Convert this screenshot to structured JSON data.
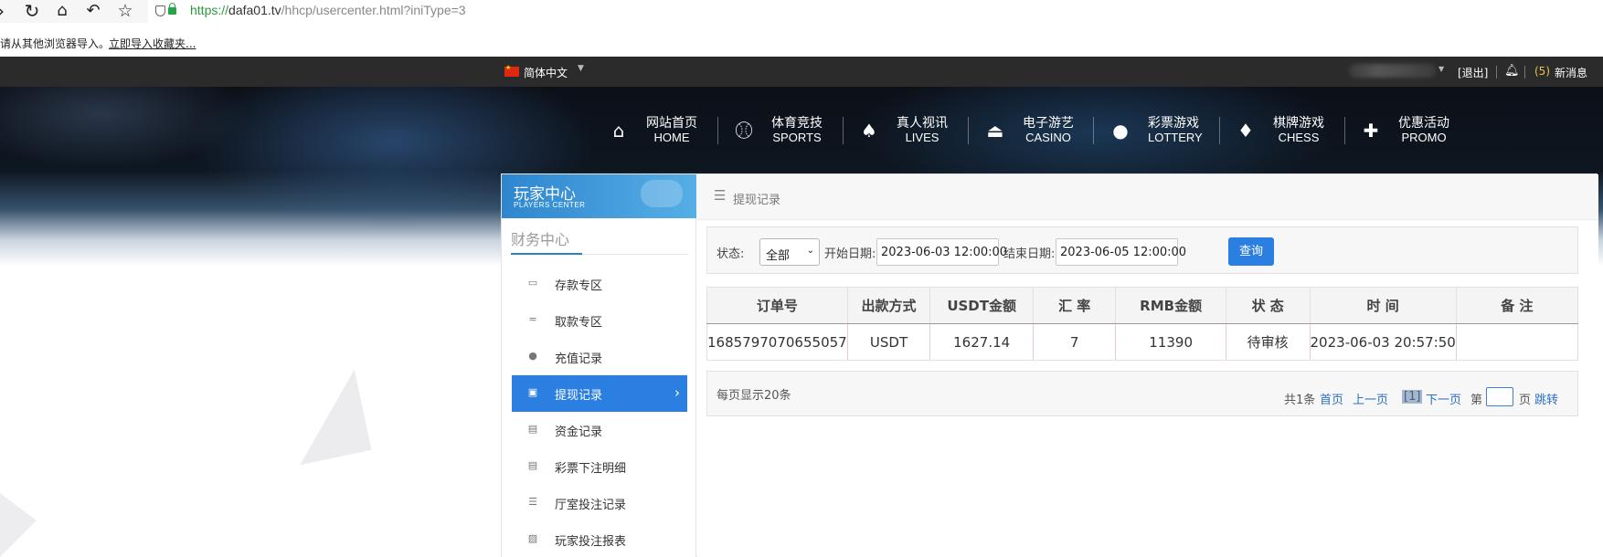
{
  "browser": {
    "url_scheme": "https://",
    "url_host": "dafa01.tv",
    "url_path": "/hhcp/usercenter.html?iniType=3"
  },
  "import_bar": {
    "text": "请从其他浏览器导入。",
    "link": "立即导入收藏夹..."
  },
  "topbar": {
    "language": "简体中文",
    "logout": "[退出]",
    "message_count": "(5)",
    "message_label": "新消息"
  },
  "main_nav": [
    {
      "cn": "网站首页",
      "en": "HOME",
      "icon": "home-icon"
    },
    {
      "cn": "体育竞技",
      "en": "SPORTS",
      "icon": "ball-icon"
    },
    {
      "cn": "真人视讯",
      "en": "LIVES",
      "icon": "cards-icon"
    },
    {
      "cn": "电子游艺",
      "en": "CASINO",
      "icon": "joystick-icon"
    },
    {
      "cn": "彩票游戏",
      "en": "LOTTERY",
      "icon": "lottery-balls-icon"
    },
    {
      "cn": "棋牌游戏",
      "en": "CHESS",
      "icon": "spade-icon"
    },
    {
      "cn": "优惠活动",
      "en": "PROMO",
      "icon": "gift-icon"
    }
  ],
  "sidebar": {
    "title": "玩家中心",
    "subtitle": "PLAYERS CENTER",
    "section": "财务中心",
    "items": [
      {
        "label": "存款专区",
        "icon": "deposit-icon",
        "active": false
      },
      {
        "label": "取款专区",
        "icon": "withdraw-icon",
        "active": false
      },
      {
        "label": "充值记录",
        "icon": "money-bag-icon",
        "active": false
      },
      {
        "label": "提现记录",
        "icon": "wallet-icon",
        "active": true
      },
      {
        "label": "资金记录",
        "icon": "funds-icon",
        "active": false
      },
      {
        "label": "彩票下注明细",
        "icon": "ticket-icon",
        "active": false
      },
      {
        "label": "厅室投注记录",
        "icon": "list-icon",
        "active": false
      },
      {
        "label": "玩家投注报表",
        "icon": "report-icon",
        "active": false
      }
    ]
  },
  "breadcrumb": "提现记录",
  "filter": {
    "status_label": "状态:",
    "status_value": "全部",
    "start_label": "开始日期:",
    "start_value": "2023-06-03 12:00:00",
    "end_label": "结束日期:",
    "end_value": "2023-06-05 12:00:00",
    "query_button": "查询"
  },
  "table": {
    "headers": [
      "订单号",
      "出款方式",
      "USDT金额",
      "汇 率",
      "RMB金额",
      "状 态",
      "时 间",
      "备 注"
    ],
    "rows": [
      [
        "1685797070655057",
        "USDT",
        "1627.14",
        "7",
        "11390",
        "待审核",
        "2023-06-03 20:57:50",
        ""
      ]
    ]
  },
  "pager": {
    "per_page": "每页显示20条",
    "total": "共1条",
    "first": "首页",
    "prev": "上一页",
    "current": "[1]",
    "next": "下一页",
    "page_prefix": "第",
    "page_suffix": "页",
    "jump": "跳转"
  }
}
